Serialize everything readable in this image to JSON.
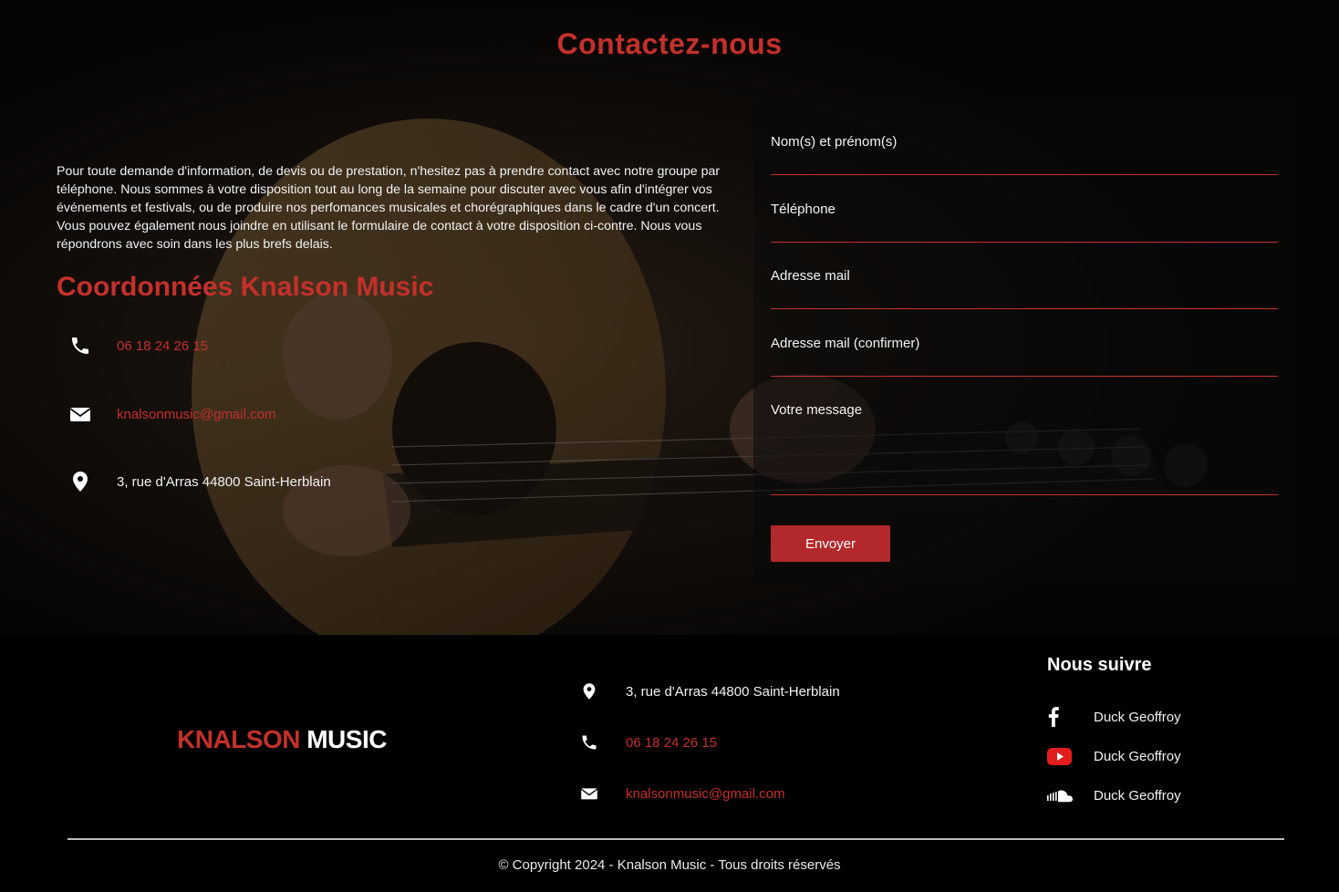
{
  "contact_section": {
    "title": "Contactez-nous",
    "intro": "Pour toute demande d'information, de devis ou de prestation, n'hesitez pas à prendre contact avec notre groupe par téléphone. Nous sommes à votre disposition tout au long de la semaine pour discuter avec vous afin d'intégrer vos événements et festivals, ou de produire nos perfomances musicales et chorégraphiques dans le cadre d'un concert. Vous pouvez également nous joindre en utilisant le formulaire de contact à votre disposition ci-contre. Nous vous répondrons avec soin dans les plus brefs delais.",
    "coord_title": "Coordonnées Knalson Music",
    "phone": "06 18 24 26 15",
    "email": "knalsonmusic@gmail.com",
    "address": "3, rue d'Arras 44800 Saint-Herblain"
  },
  "form": {
    "name_label": "Nom(s) et prénom(s)",
    "phone_label": "Téléphone",
    "email_label": "Adresse mail",
    "email_confirm_label": "Adresse mail (confirmer)",
    "message_label": "Votre message",
    "submit_label": "Envoyer"
  },
  "footer": {
    "logo_part1": "KNALSON",
    "logo_part2": "MUSIC",
    "address": "3, rue d'Arras 44800 Saint-Herblain",
    "phone": "06 18 24 26 15",
    "email": "knalsonmusic@gmail.com",
    "follow_title": "Nous suivre",
    "socials": [
      {
        "icon": "facebook-icon",
        "label": "Duck Geoffroy"
      },
      {
        "icon": "youtube-icon",
        "label": "Duck Geoffroy"
      },
      {
        "icon": "soundcloud-icon",
        "label": "Duck Geoffroy"
      }
    ],
    "copyright": "© Copyright 2024 - Knalson Music - Tous droits réservés"
  },
  "colors": {
    "accent": "#c4302b",
    "button": "#b3282a",
    "background": "#000000"
  }
}
